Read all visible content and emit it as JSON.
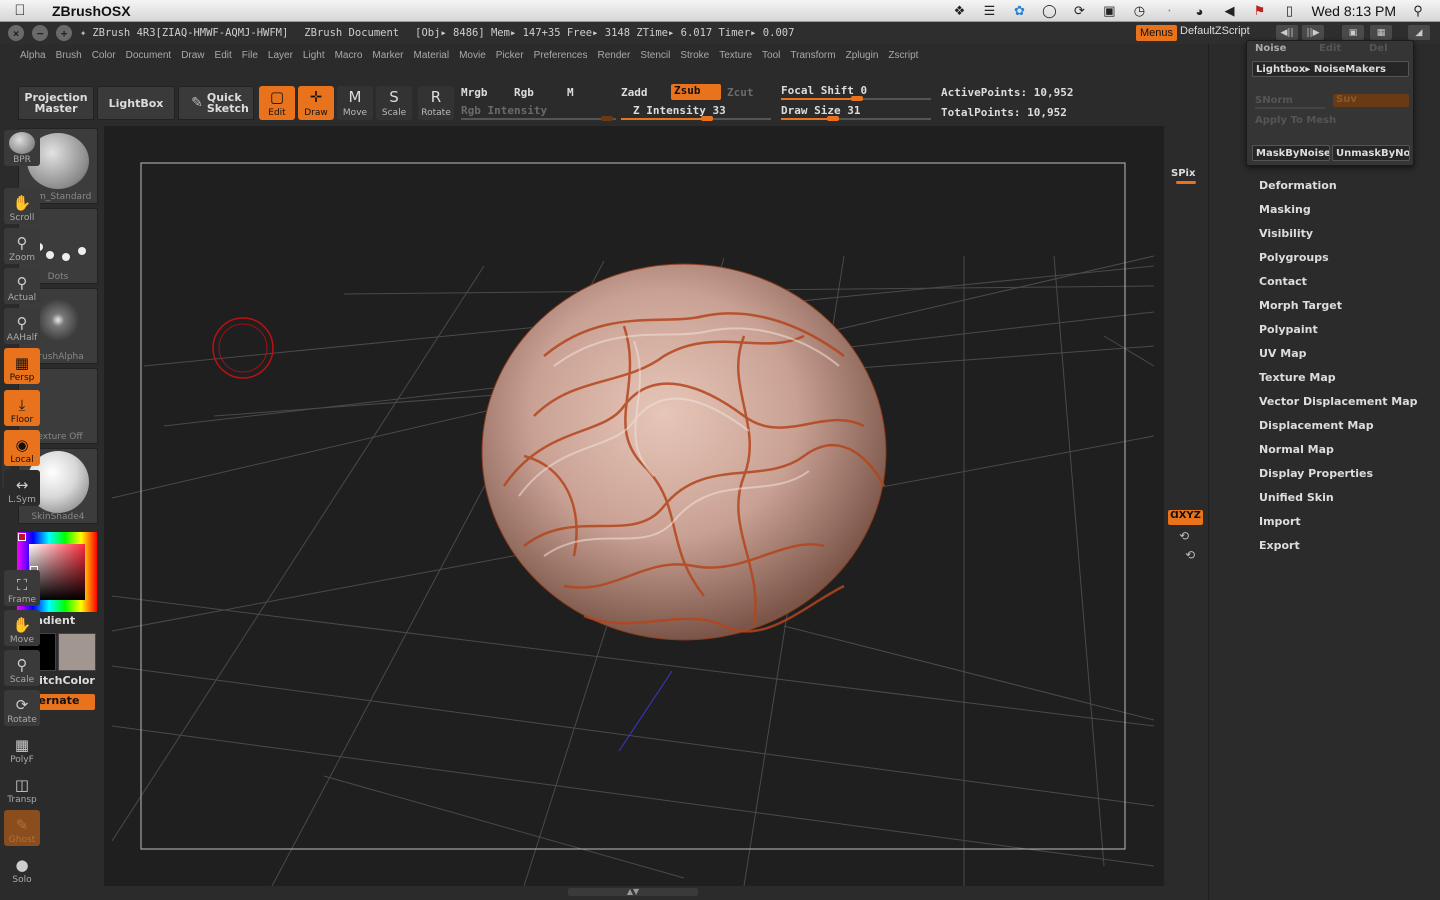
{
  "macbar": {
    "app_name": "ZBrushOSX",
    "clock": "Wed 8:13 PM"
  },
  "titlebar": {
    "doc_id": "ZBrush 4R3[ZIAQ-HMWF-AQMJ-HWFM]",
    "doc_label": "ZBrush Document",
    "stats": "[Obj▸ 8486] Mem▸ 147+35 Free▸ 3148 ZTime▸ 6.017 Timer▸ 0.007",
    "menus_label": "Menus",
    "script_name": "DefaultZScript"
  },
  "menubar": [
    "Alpha",
    "Brush",
    "Color",
    "Document",
    "Draw",
    "Edit",
    "File",
    "Layer",
    "Light",
    "Macro",
    "Marker",
    "Material",
    "Movie",
    "Picker",
    "Preferences",
    "Render",
    "Stencil",
    "Stroke",
    "Texture",
    "Tool",
    "Transform",
    "Zplugin",
    "Zscript"
  ],
  "shelf": {
    "projection_master": "Projection Master",
    "lightbox": "LightBox",
    "quick_sketch": "Quick Sketch",
    "edit": "Edit",
    "draw": "Draw",
    "move": "Move",
    "scale": "Scale",
    "rotate": "Rotate",
    "mrgb": "Mrgb",
    "rgb": "Rgb",
    "m": "M",
    "rgb_intensity": "Rgb Intensity",
    "zadd": "Zadd",
    "zsub": "Zsub",
    "zcut": "Zcut",
    "z_intensity": "Z Intensity 33",
    "focal_shift": "Focal Shift 0",
    "draw_size": "Draw Size 31",
    "active_points": "ActivePoints: 10,952",
    "total_points": "TotalPoints: 10,952",
    "z_intensity_value": 33,
    "focal_shift_value": 0,
    "draw_size_value": 31
  },
  "left_tray": {
    "brush": "Dam_Standard",
    "stroke": "Dots",
    "alpha": "BrushAlpha",
    "texture": "Texture Off",
    "material": "SkinShade4",
    "gradient": "Gradient",
    "switch_color": "SwitchColor",
    "alternate": "Alternate"
  },
  "right_tray": {
    "bpr": "BPR",
    "spix": "SPix",
    "scroll": "Scroll",
    "zoom": "Zoom",
    "actual": "Actual",
    "aahalf": "AAHalf",
    "persp": "Persp",
    "floor": "Floor",
    "local": "Local",
    "lsym": "L.Sym",
    "xyz": "ⱭXYZ",
    "frame": "Frame",
    "move": "Move",
    "scale": "Scale",
    "rotate": "Rotate",
    "polyf": "PolyF",
    "transp": "Transp",
    "ghost": "Ghost",
    "solo": "Solo"
  },
  "noise_popup": {
    "noise": "Noise",
    "edit": "Edit",
    "del": "Del",
    "lightbox_noisemakers": "Lightbox▸ NoiseMakers",
    "snorm": "SNorm",
    "suv": "Suv",
    "apply_to_mesh": "Apply To Mesh",
    "mask_by_noise": "MaskByNoise",
    "unmask_by_noise": "UnmaskByNo"
  },
  "palette_items": [
    "Deformation",
    "Masking",
    "Visibility",
    "Polygroups",
    "Contact",
    "Morph Target",
    "Polypaint",
    "UV Map",
    "Texture Map",
    "Vector Displacement Map",
    "Displacement Map",
    "Normal Map",
    "Display Properties",
    "Unified Skin",
    "Import",
    "Export"
  ],
  "colors": {
    "accent": "#e8731c",
    "ui_bg": "#2b2b2b",
    "canvas_bg": "#1f1f1f",
    "model_skin": "#c9a194",
    "model_crease": "#b4451c"
  }
}
